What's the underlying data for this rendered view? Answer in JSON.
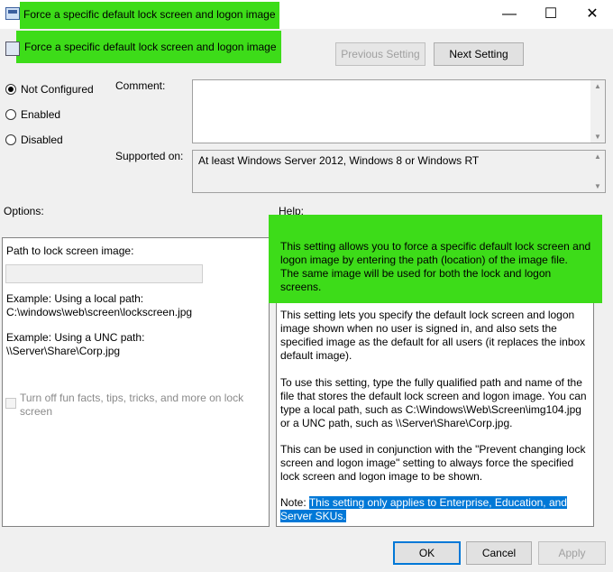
{
  "window": {
    "title": "Force a specific default lock screen and logon image",
    "minimize_glyph": "—",
    "maximize_glyph": "☐",
    "close_glyph": "✕"
  },
  "header": {
    "setting_name": "Force a specific default lock screen and logon image",
    "previous_label": "Previous Setting",
    "next_label": "Next Setting"
  },
  "state": {
    "options": [
      {
        "label": "Not Configured",
        "checked": true
      },
      {
        "label": "Enabled",
        "checked": false
      },
      {
        "label": "Disabled",
        "checked": false
      }
    ]
  },
  "comment": {
    "label": "Comment:",
    "value": ""
  },
  "supported": {
    "label": "Supported on:",
    "value": "At least Windows Server 2012, Windows 8 or Windows RT"
  },
  "options_panel": {
    "heading": "Options:",
    "path_label": "Path to lock screen image:",
    "path_value": "",
    "example_local_title": "Example: Using a local path:",
    "example_local_value": "C:\\windows\\web\\screen\\lockscreen.jpg",
    "example_unc_title": "Example: Using a UNC path:",
    "example_unc_value": "\\\\Server\\Share\\Corp.jpg",
    "checkbox_line1": "Turn off fun facts, tips, tricks, and more on lock",
    "checkbox_line2": "screen",
    "checkbox_checked": false
  },
  "help": {
    "heading": "Help:",
    "p1": [
      "This setting allows you to force a specific default lock screen and",
      "logon image by entering the path (location) of the image file.",
      "The same image will be used for both the lock and logon",
      "screens."
    ],
    "p2": [
      "This setting lets you specify the default lock screen and logon",
      "image shown when no user is signed in, and also sets the",
      "specified image as the default for all users (it replaces the inbox",
      "default image)."
    ],
    "p3": [
      "To use this setting, type the fully qualified path and name of the",
      "file that stores the default lock screen and logon image. You can",
      "type a local path, such as C:\\Windows\\Web\\Screen\\img104.jpg",
      "or a UNC path, such as \\\\Server\\Share\\Corp.jpg."
    ],
    "p4": [
      "This can be used in conjunction with the \"Prevent changing lock",
      "screen and logon image\" setting to always force the specified",
      "lock screen and logon image to be shown."
    ],
    "note_prefix": "Note: ",
    "note_line1": "This setting only applies to Enterprise, Education, and",
    "note_line2": "Server SKUs."
  },
  "footer": {
    "ok": "OK",
    "cancel": "Cancel",
    "apply": "Apply"
  },
  "colors": {
    "highlight_green": "#3ddc19",
    "selection_blue": "#0078d7"
  }
}
